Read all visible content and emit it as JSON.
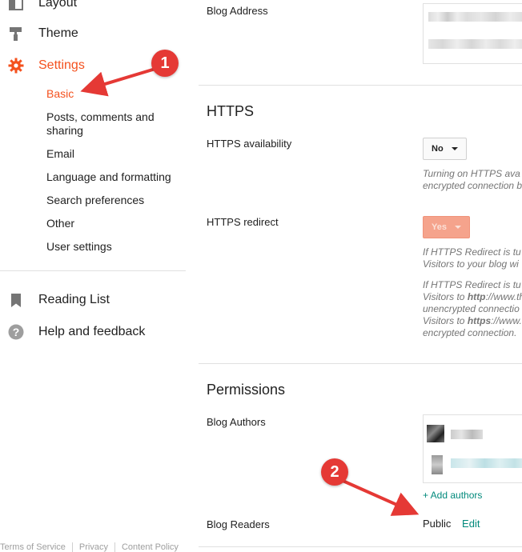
{
  "sidebar": {
    "layout_label": "Layout",
    "theme_label": "Theme",
    "settings_label": "Settings",
    "sub_items": [
      "Basic",
      "Posts, comments and",
      "sharing",
      "Email",
      "Language and formatting",
      "Search preferences",
      "Other",
      "User settings"
    ],
    "reading_list_label": "Reading List",
    "help_label": "Help and feedback",
    "footer": [
      "Terms of Service",
      "Privacy",
      "Content Policy"
    ],
    "accent_color": "#f4511e"
  },
  "main": {
    "blog_address_label": "Blog Address",
    "https_title": "HTTPS",
    "https_availability_label": "HTTPS availability",
    "https_availability_value": "No",
    "https_availability_help": [
      "Turning on HTTPS ava",
      "encrypted connection b"
    ],
    "https_redirect_label": "HTTPS redirect",
    "https_redirect_value": "Yes",
    "https_redirect_help1": [
      "If HTTPS Redirect is tu",
      "Visitors to your blog wi"
    ],
    "https_redirect_help2": {
      "line1": "If HTTPS Redirect is tu",
      "line2_prefix": "Visitors to ",
      "line2_bold": "http",
      "line2_suffix": "://www.th",
      "line3": "unencrypted connectio",
      "line4_prefix": "Visitors to ",
      "line4_bold": "https",
      "line4_suffix": "://www.t",
      "line5": "encrypted connection."
    },
    "permissions_title": "Permissions",
    "blog_authors_label": "Blog Authors",
    "add_authors_link": "+ Add authors",
    "blog_readers_label": "Blog Readers",
    "blog_readers_value": "Public",
    "blog_readers_edit": "Edit"
  },
  "annotations": [
    "1",
    "2"
  ]
}
